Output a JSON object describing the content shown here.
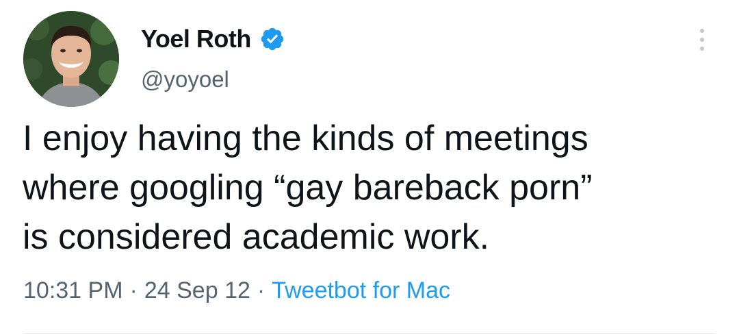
{
  "tweet": {
    "author": {
      "display_name": "Yoel Roth",
      "handle": "@yoyoel",
      "verified": true
    },
    "text_lines": [
      "I enjoy having the kinds of meetings",
      "where googling “gay bareback porn”",
      "is considered academic work."
    ],
    "time": "10:31 PM",
    "date": "24 Sep 12",
    "separator": "·",
    "source": "Tweetbot for Mac"
  },
  "icons": {
    "verified": "verified-badge-icon",
    "more": "more-options-icon"
  },
  "colors": {
    "text": "#0f1419",
    "secondary": "#536471",
    "link": "#1d9bf0",
    "verified": "#1d9bf0"
  }
}
